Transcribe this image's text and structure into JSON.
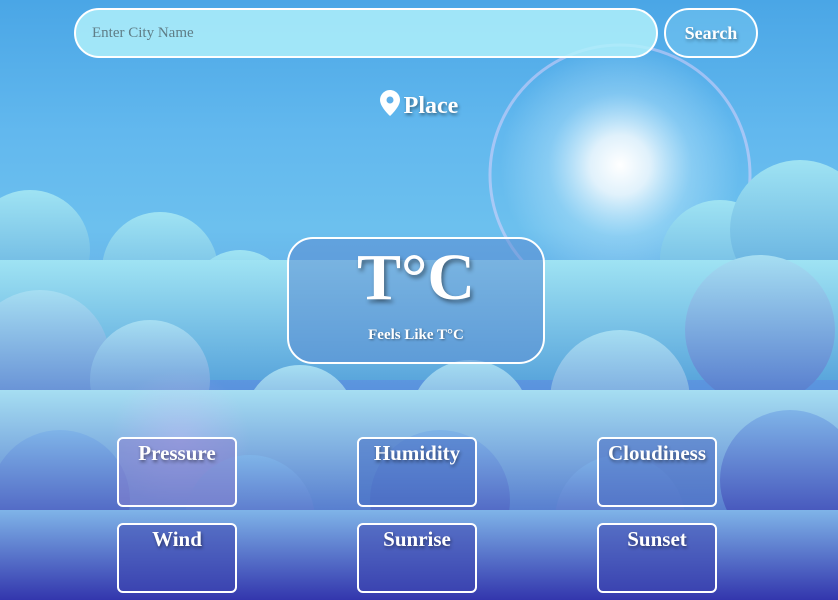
{
  "search": {
    "placeholder": "Enter City Name",
    "value": "",
    "button_label": "Search"
  },
  "location": {
    "icon": "map-pin-icon",
    "place": "Place"
  },
  "weather": {
    "temperature": "T°C",
    "feels_like": "Feels Like T°C"
  },
  "stats": [
    {
      "label": "Pressure"
    },
    {
      "label": "Humidity"
    },
    {
      "label": "Cloudiness"
    },
    {
      "label": "Wind"
    },
    {
      "label": "Sunrise"
    },
    {
      "label": "Sunset"
    }
  ],
  "colors": {
    "sky_top": "#4aa6e6",
    "sky_bottom": "#3a3db5",
    "border": "#ffffff",
    "search_fill": "#aff0fa"
  }
}
